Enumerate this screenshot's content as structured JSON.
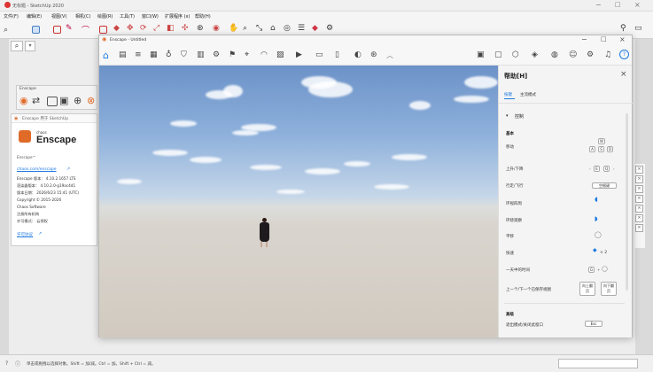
{
  "sketchup": {
    "title": "无标题 - SketchUp 2020",
    "menus": [
      "文件(F)",
      "编辑(E)",
      "视图(V)",
      "相机(C)",
      "绘图(R)",
      "工具(T)",
      "窗口(W)",
      "扩展程序 (x)",
      "帮助(H)"
    ],
    "status_text": "单击或拖拽以选择对象。Shift = 加/减。Ctrl = 加。Shift + Ctrl = 减。"
  },
  "enscape_mini": {
    "title": "Enscape"
  },
  "about": {
    "title": "Enscape 用于 SketchUp",
    "brand_small": "chaos",
    "brand_big": "Enscape",
    "brand_mark": "Enscape™",
    "link": "chaos.com/enscape",
    "version": "Enscape 版本： 4.10.2.1657 LTS",
    "renderer": "渲染器版本： 4.10.2.0-g19ac4d1",
    "build_date": "版本日期： 2026/6/23 15:41 (UTC)",
    "copyright": "Copyright © 2015-2026",
    "company": "Chaos Software",
    "license_org": "注册所有机构",
    "license_mode": "许可模式： 云授权",
    "license_link": "许可协议"
  },
  "enscape": {
    "window_title": "Enscape - Untitled"
  },
  "help": {
    "title": "帮助[H]",
    "tabs": [
      "按键",
      "主流模式"
    ],
    "section_control": "控制",
    "section_basic": "基本",
    "rows": [
      {
        "label": "移动",
        "keys": [
          "W",
          "A",
          "S",
          "D"
        ]
      },
      {
        "label": "上升/下降",
        "keys": [
          "E",
          "Q"
        ]
      },
      {
        "label": "行走/飞行",
        "keys": [
          "空格键"
        ]
      },
      {
        "label": "环视四周",
        "keys": []
      },
      {
        "label": "环绕观察",
        "keys": []
      },
      {
        "label": "平移",
        "keys": []
      },
      {
        "label": "快速",
        "keys": [
          "× 2"
        ]
      },
      {
        "label": "一天中的时间",
        "keys": [
          "G"
        ]
      },
      {
        "label": "上一个/下一个已保存视图",
        "keys": [
          "向上翻页",
          "向下翻页"
        ]
      }
    ],
    "section_advanced": "高级",
    "last_label": "退出模式/关闭此窗口",
    "last_key": "Esc"
  },
  "colors": {
    "accent": "#1e7be0",
    "enscape_orange": "#e06a28"
  }
}
